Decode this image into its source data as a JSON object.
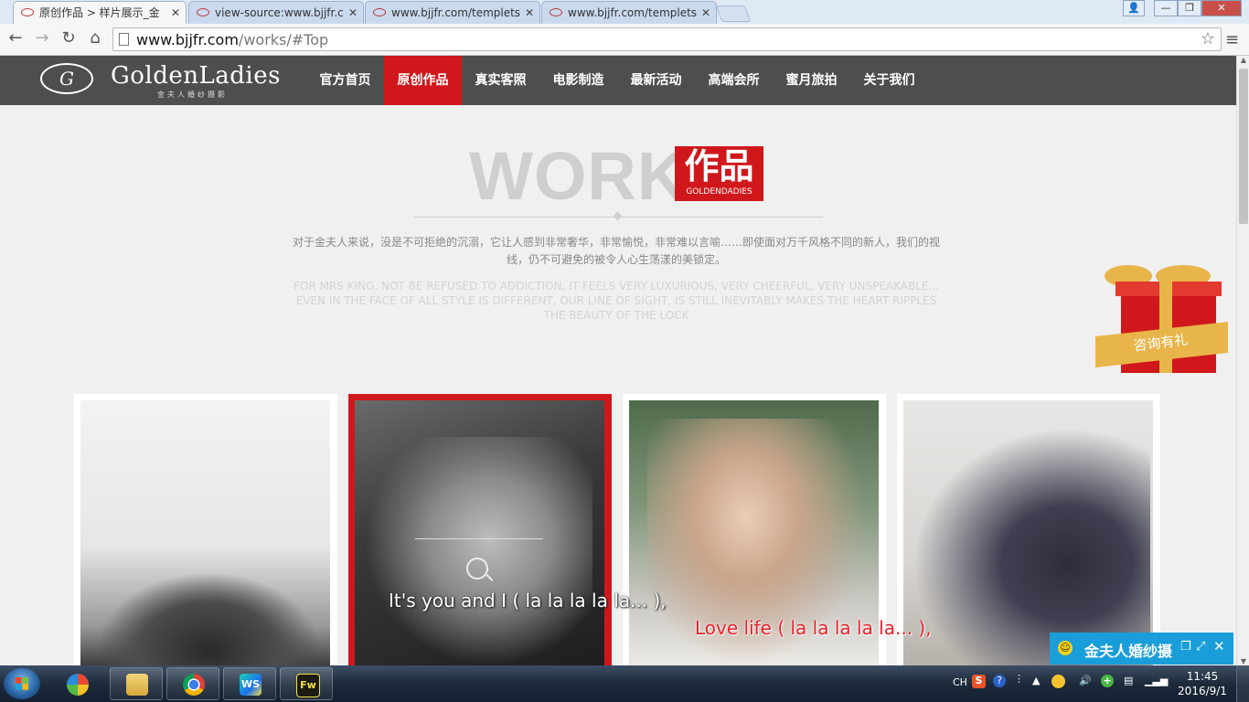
{
  "browser": {
    "tabs": [
      {
        "title": "原创作品 > 样片展示_金",
        "active": true
      },
      {
        "title": "view-source:www.bjjfr.c",
        "active": false
      },
      {
        "title": "www.bjjfr.com/templets",
        "active": false
      },
      {
        "title": "www.bjjfr.com/templets",
        "active": false
      }
    ],
    "url_host": "www.bjjfr.com",
    "url_path": "/works/#Top",
    "window_controls": {
      "minimize": "—",
      "restore": "❐",
      "close": "✕"
    }
  },
  "site": {
    "logo_letter": "G",
    "logo_text": "GoldenLadies",
    "logo_sub": "金夫人婚纱摄影",
    "nav": [
      "官方首页",
      "原创作品",
      "真实客照",
      "电影制造",
      "最新活动",
      "高端会所",
      "蜜月旅拍",
      "关于我们"
    ],
    "active_nav": "原创作品"
  },
  "works": {
    "title": "WORKS",
    "badge_cn": "作品",
    "badge_en": "GOLDENDADIES",
    "intro_cn": "对于金夫人来说，没是不可拒绝的沉溺，它让人感到非常奢华，非常愉悦，非常难以言喻……即使面对万千风格不同的新人，我们的视线，仍不可避免的被令人心生荡漾的美锁定。",
    "intro_en": "FOR MRS KING, NOT BE REFUSED TO ADDICTION, IT FEELS VERY LUXURIOUS, VERY CHEERFUL, VERY UNSPEAKABLE... EVEN IN THE FACE OF ALL STYLE IS DIFFERENT, OUR LINE OF SIGHT, IS STILL INEVITABLY MAKES THE HEART RIPPLES THE BEAUTY OF THE LOCK"
  },
  "gift": {
    "label": "咨询有礼",
    "colors": {
      "box": "#d0181c",
      "ribbon": "#e8b54a"
    }
  },
  "cards": [
    {
      "alt": "black-and-white photo of bride",
      "highlight": false
    },
    {
      "alt": "black-and-white photo of couple",
      "highlight": true
    },
    {
      "alt": "color photo of couple touching foreheads",
      "highlight": false
    },
    {
      "alt": "color photo of couple in suit and dress",
      "highlight": false
    }
  ],
  "lyrics": {
    "line1": "It's you and I ( la la la la la... ),",
    "line2": "Love life ( la la la la la... ),"
  },
  "chat": {
    "name": "金夫人婚纱摄",
    "icons": [
      "restore-icon",
      "expand-icon",
      "close-icon"
    ]
  },
  "taskbar": {
    "apps": [
      "Pinwheel app",
      "Windows Explorer",
      "Google Chrome",
      "WebStorm",
      "Fireworks"
    ],
    "webstorm_label": "WS",
    "fireworks_label": "Fw",
    "tray": {
      "lang": "CH",
      "sogou": "S"
    },
    "time": "11:45",
    "date": "2016/9/1"
  },
  "colors": {
    "accent_red": "#d0181c",
    "nav_bg": "#4e4e4e",
    "chat_blue": "#1a9ed9"
  }
}
